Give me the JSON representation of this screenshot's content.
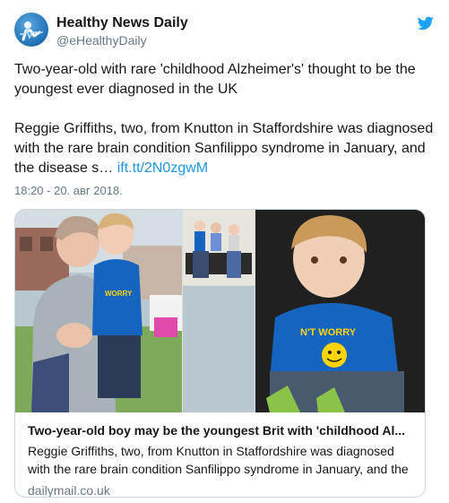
{
  "author": {
    "name": "Healthy News Daily",
    "handle": "@eHealthyDaily",
    "avatar_icon": "healthy-news-logo",
    "brand_icon": "twitter-bird-icon",
    "brand_color": "#1da1f2"
  },
  "tweet": {
    "headline": "Two-year-old with rare 'childhood Alzheimer's' thought to be the youngest ever diagnosed in the UK",
    "body": "Reggie Griffiths, two, from Knutton in Staffordshire was diagnosed with the rare brain condition Sanfilippo syndrome in January, and the disease s…",
    "link_text": "ift.tt/2N0zgwM",
    "link_color": "#1b95e0",
    "timestamp": "18:20 - 20. авг 2018."
  },
  "card": {
    "title": "Two-year-old boy may be the youngest Brit with 'childhood Al...",
    "description": "Reggie Griffiths, two, from Knutton in Staffordshire was diagnosed with the rare brain condition Sanfilippo syndrome in January, and the",
    "domain": "dailymail.co.uk",
    "shirt_text": "N'T WORRY"
  }
}
